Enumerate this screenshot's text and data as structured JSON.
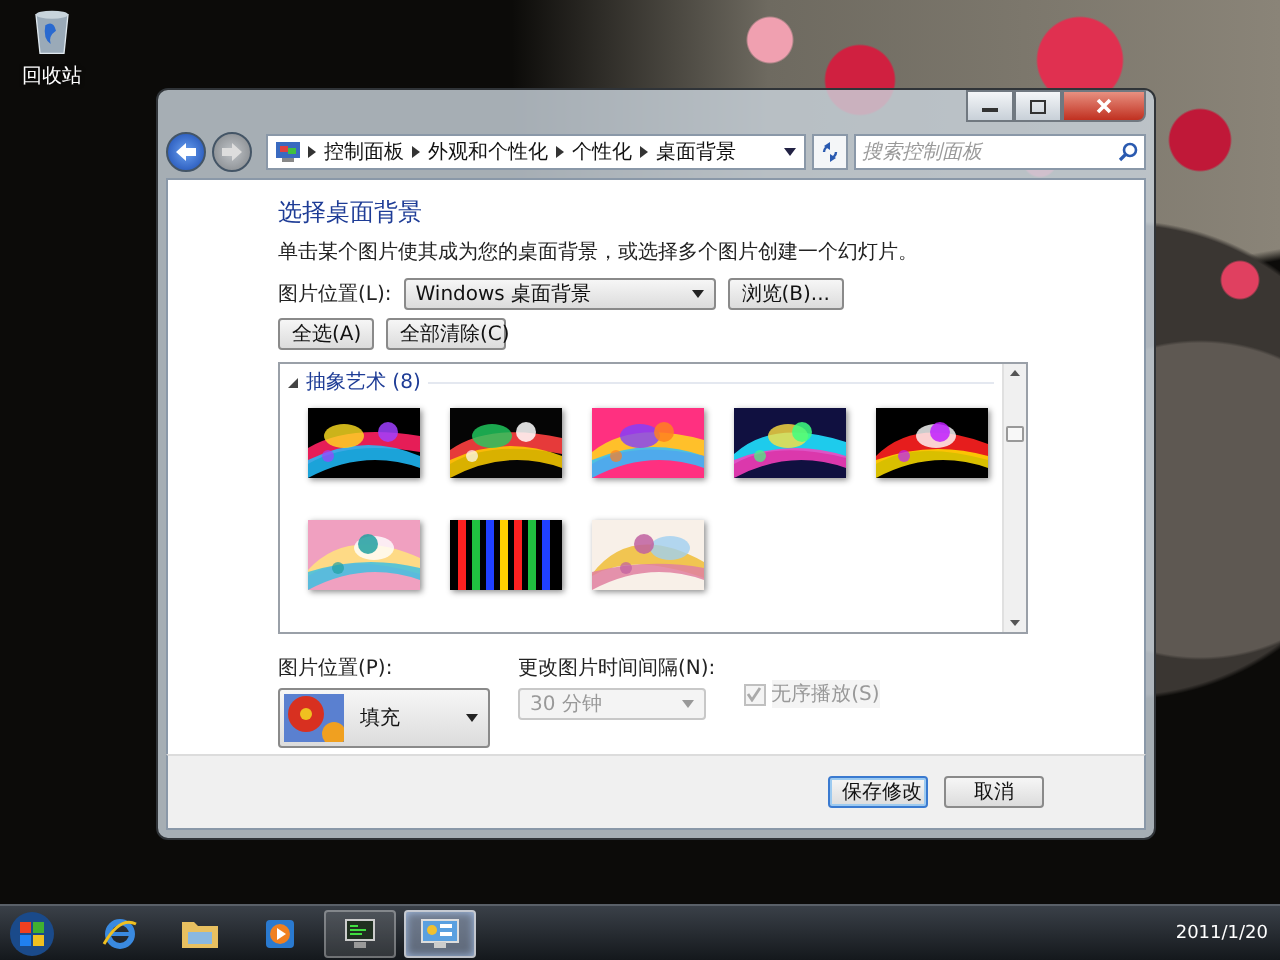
{
  "desktop": {
    "icons": [
      {
        "label": "回收站"
      }
    ]
  },
  "window": {
    "breadcrumb": [
      "控制面板",
      "外观和个性化",
      "个性化",
      "桌面背景"
    ],
    "search": {
      "placeholder": "搜索控制面板"
    },
    "heading": "选择桌面背景",
    "description": "单击某个图片使其成为您的桌面背景，或选择多个图片创建一个幻灯片。",
    "location": {
      "label": "图片位置(L):",
      "value": "Windows 桌面背景"
    },
    "browse_button": "浏览(B)...",
    "select_all_button": "全选(A)",
    "clear_all_button": "全部清除(C)",
    "gallery": {
      "group": "抽象艺术 (8)",
      "expanded": true
    },
    "position": {
      "label": "图片位置(P):",
      "value": "填充"
    },
    "interval": {
      "label": "更改图片时间间隔(N):",
      "value": "30 分钟",
      "disabled": true
    },
    "shuffle": {
      "label": "无序播放(S)",
      "checked": true,
      "disabled": true
    },
    "buttons": [
      {
        "label": "保存修改",
        "default": true
      },
      {
        "label": "取消",
        "default": false
      }
    ]
  },
  "taskbar": {
    "apps": [
      {
        "kind": "browser",
        "running": false,
        "selected": false
      },
      {
        "kind": "folder",
        "running": false,
        "selected": false
      },
      {
        "kind": "media",
        "running": false,
        "selected": false
      },
      {
        "kind": "monitor",
        "running": true,
        "selected": false
      },
      {
        "kind": "control-panel",
        "running": true,
        "selected": true
      }
    ],
    "clock": {
      "date": "2011/1/20"
    }
  }
}
